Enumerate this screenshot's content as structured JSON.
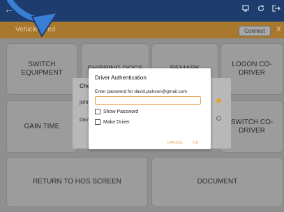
{
  "topbar": {
    "back_glyph": "←",
    "title": "o",
    "icons": [
      "device-icon",
      "refresh-icon",
      "logout-icon"
    ]
  },
  "statusbar": {
    "label": "Vehicle ... ed",
    "connect_label": "Connect",
    "close_glyph": "X"
  },
  "menu": {
    "switch_equipment": "SWITCH\nEQUIPMENT",
    "shipping_docs": "SHIPPING DOCS",
    "remark": "REMARK",
    "logon_codriver": "LOGON CO-DRIVER",
    "gain_time": "GAIN TIME",
    "switch_codriver": "SWITCH CO-\nDRIVER",
    "return_hos": "RETURN TO HOS SCREEN",
    "document": "DOCUMENT"
  },
  "background_card": {
    "heading": "Cho",
    "row1": "johr",
    "row2": "davi",
    "foot": "OOSI"
  },
  "dialog": {
    "title": "Driver Authentication",
    "prompt": "Enter password for david.jackson@gmail.com",
    "password_value": "",
    "show_password_label": "Show Password",
    "make_driver_label": "Make Driver",
    "cancel_label": "CANCEL",
    "ok_label": "OK"
  },
  "colors": {
    "topbar": "#1f3c6e",
    "statusbar": "#a8782e",
    "accent": "#e6a23c",
    "arrow": "#3a7fd6"
  }
}
